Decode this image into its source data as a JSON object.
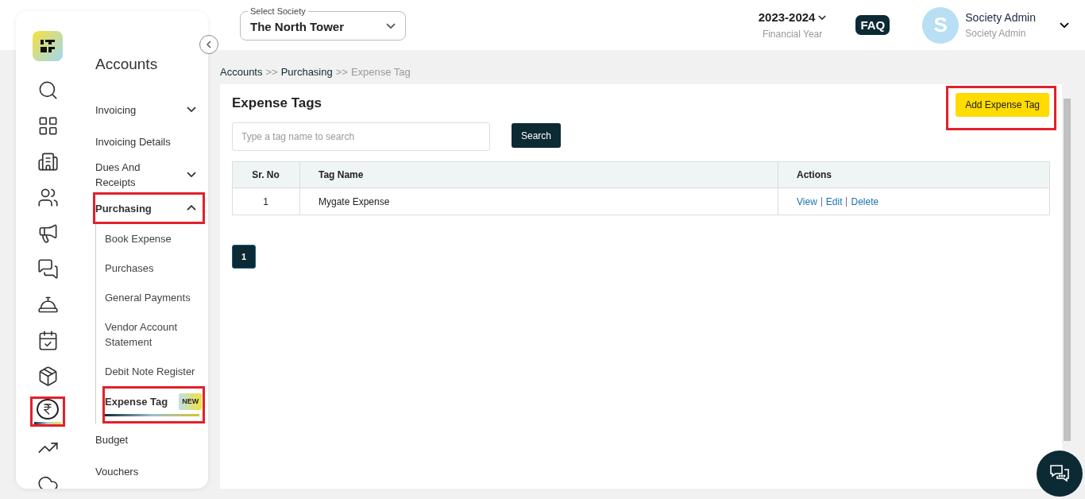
{
  "rail": [
    {
      "kind": "search",
      "selected": false,
      "annotated": false
    },
    {
      "kind": "grid",
      "selected": false,
      "annotated": false
    },
    {
      "kind": "building",
      "selected": false,
      "annotated": false
    },
    {
      "kind": "people",
      "selected": false,
      "annotated": false
    },
    {
      "kind": "megaphone",
      "selected": false,
      "annotated": false
    },
    {
      "kind": "chat",
      "selected": false,
      "annotated": false
    },
    {
      "kind": "desk",
      "selected": false,
      "annotated": false
    },
    {
      "kind": "calendar",
      "selected": false,
      "annotated": false
    },
    {
      "kind": "box",
      "selected": false,
      "annotated": false
    },
    {
      "kind": "rupee",
      "selected": true,
      "annotated": true
    },
    {
      "kind": "report",
      "selected": false,
      "annotated": false
    },
    {
      "kind": "partial",
      "selected": false,
      "annotated": false
    }
  ],
  "menu": {
    "title": "Accounts",
    "items": [
      {
        "label": "Invoicing",
        "kind": "group",
        "expanded": false,
        "annotated": false
      },
      {
        "label": "Invoicing Details",
        "kind": "link",
        "annotated": false
      },
      {
        "label": "Dues And Receipts",
        "kind": "group",
        "expanded": false,
        "annotated": false
      },
      {
        "label": "Purchasing",
        "kind": "group",
        "expanded": true,
        "annotated": true,
        "children": [
          {
            "label": "Book Expense",
            "selected": false,
            "annotated": false
          },
          {
            "label": "Purchases",
            "selected": false,
            "annotated": false
          },
          {
            "label": "General Payments",
            "selected": false,
            "annotated": false
          },
          {
            "label": "Vendor Account Statement",
            "selected": false,
            "annotated": false
          },
          {
            "label": "Debit Note Register",
            "selected": false,
            "annotated": false
          },
          {
            "label": "Expense Tag",
            "selected": true,
            "annotated": true,
            "badge": "NEW"
          }
        ]
      },
      {
        "label": "Budget",
        "kind": "link",
        "annotated": false
      },
      {
        "label": "Vouchers",
        "kind": "link",
        "annotated": false
      }
    ]
  },
  "header": {
    "society": {
      "label": "Select Society",
      "value": "The North Tower"
    },
    "year": {
      "value": "2023-2024",
      "caption": "Financial Year"
    },
    "faq": "FAQ",
    "user": {
      "initial": "S",
      "name": "Society Admin",
      "role": "Society Admin"
    }
  },
  "breadcrumb": [
    {
      "label": "Accounts",
      "current": false
    },
    {
      "label": "Purchasing",
      "current": false
    },
    {
      "label": "Expense Tag",
      "current": true
    }
  ],
  "breadcrumb_separator": ">>",
  "page": {
    "title": "Expense Tags",
    "add_button": {
      "label": "Add Expense Tag",
      "annotated": true
    },
    "search": {
      "placeholder": "Type a tag name to search",
      "button": "Search"
    },
    "table": {
      "columns": [
        "Sr. No",
        "Tag Name",
        "Actions"
      ],
      "rows": [
        {
          "sr": "1",
          "name": "Mygate Expense",
          "actions": [
            "View",
            "Edit",
            "Delete"
          ]
        }
      ]
    },
    "pagination": [
      {
        "label": "1",
        "selected": true
      }
    ]
  }
}
